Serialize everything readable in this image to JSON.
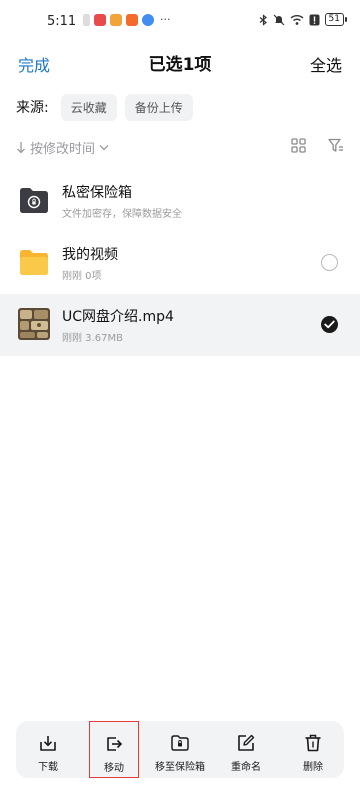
{
  "status_bar": {
    "time": "5:11",
    "more": "···",
    "battery": "51"
  },
  "header": {
    "done_label": "完成",
    "title": "已选1项",
    "select_all_label": "全选"
  },
  "source": {
    "label": "来源:",
    "chips": [
      "云收藏",
      "备份上传"
    ]
  },
  "sort": {
    "label": "按修改时间"
  },
  "files": [
    {
      "name": "私密保险箱",
      "meta": "文件加密存，保障数据安全",
      "icon": "vault-folder-icon",
      "selected": false,
      "checkable": false
    },
    {
      "name": "我的视频",
      "meta": "刚刚  0项",
      "icon": "folder-icon",
      "selected": false,
      "checkable": true
    },
    {
      "name": "UC网盘介绍.mp4",
      "meta": "刚刚  3.67MB",
      "icon": "video-thumbnail",
      "selected": true,
      "checkable": true
    }
  ],
  "toolbar": {
    "download": "下载",
    "move": "移动",
    "move_to_vault": "移至保险箱",
    "rename": "重命名",
    "delete": "删除"
  },
  "colors": {
    "accent": "#1c78c6",
    "folder": "#f7b531",
    "highlight": "#e53a3a"
  }
}
